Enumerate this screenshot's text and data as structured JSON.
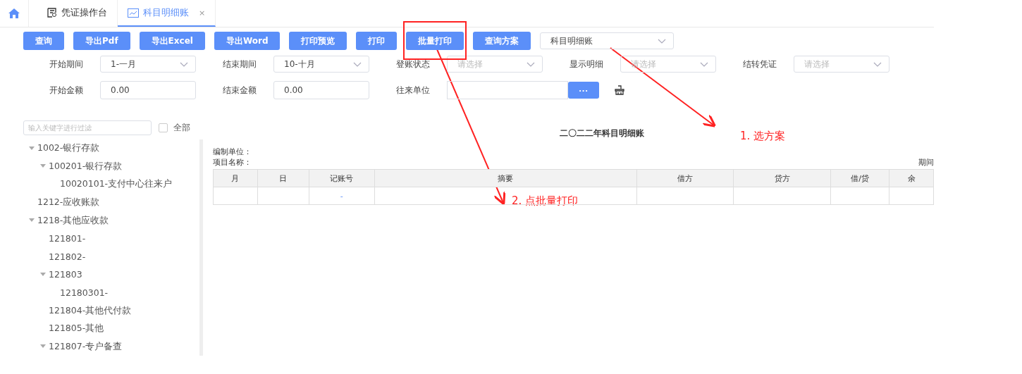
{
  "tabs": [
    {
      "label": "凭证操作台",
      "selected": false
    },
    {
      "label": "科目明细账",
      "selected": true,
      "close": "×"
    }
  ],
  "toolbar": {
    "buttons": [
      "查询",
      "导出Pdf",
      "导出Excel",
      "导出Word",
      "打印预览",
      "打印",
      "批量打印",
      "查询方案"
    ],
    "scheme_select": "科目明细账"
  },
  "filters": [
    {
      "label": "开始期间",
      "kind": "select",
      "value": "1-一月"
    },
    {
      "label": "结束期间",
      "kind": "select",
      "value": "10-十月"
    },
    {
      "label": "登账状态",
      "kind": "select",
      "placeholder": "请选择"
    },
    {
      "label": "显示明细",
      "kind": "select",
      "placeholder": "请选择"
    },
    {
      "label": "结转凭证",
      "kind": "select",
      "placeholder": "请选择"
    },
    {
      "label": "开始金额",
      "kind": "input",
      "value": "0.00"
    },
    {
      "label": "结束金额",
      "kind": "input",
      "value": "0.00"
    },
    {
      "label": "往来单位",
      "kind": "picker",
      "button": "···"
    }
  ],
  "sidebar": {
    "filter_placeholder": "输入关键字进行过滤",
    "all_label": "全部",
    "all_checked": false,
    "tree": [
      {
        "label": "1002-银行存款",
        "expanded": true,
        "children": [
          {
            "label": "100201-银行存款",
            "expanded": true,
            "children": [
              {
                "label": "10020101-支付中心往来户"
              }
            ]
          }
        ]
      },
      {
        "label": "1212-应收账款"
      },
      {
        "label": "1218-其他应收款",
        "expanded": true,
        "children": [
          {
            "label": "121801-"
          },
          {
            "label": "121802-"
          },
          {
            "label": "121803",
            "expanded": true,
            "children": [
              {
                "label": "12180301-"
              }
            ]
          },
          {
            "label": "121804-其他代付款"
          },
          {
            "label": "121805-其他"
          },
          {
            "label": "121807-专户备查",
            "expanded": true
          }
        ]
      }
    ]
  },
  "report": {
    "title": "二〇二二年科目明细账",
    "unit_label": "编制单位：",
    "item_label": "项目名称：",
    "period_label": "期间",
    "columns": [
      "月",
      "日",
      "记账号",
      "摘要",
      "借方",
      "贷方",
      "借/贷",
      "余"
    ],
    "rows": [
      [
        "",
        "",
        "-",
        "",
        "",
        "",
        "",
        ""
      ]
    ]
  },
  "annotations": [
    {
      "text": "1. 选方案"
    },
    {
      "text": "2. 点批量打印"
    }
  ]
}
